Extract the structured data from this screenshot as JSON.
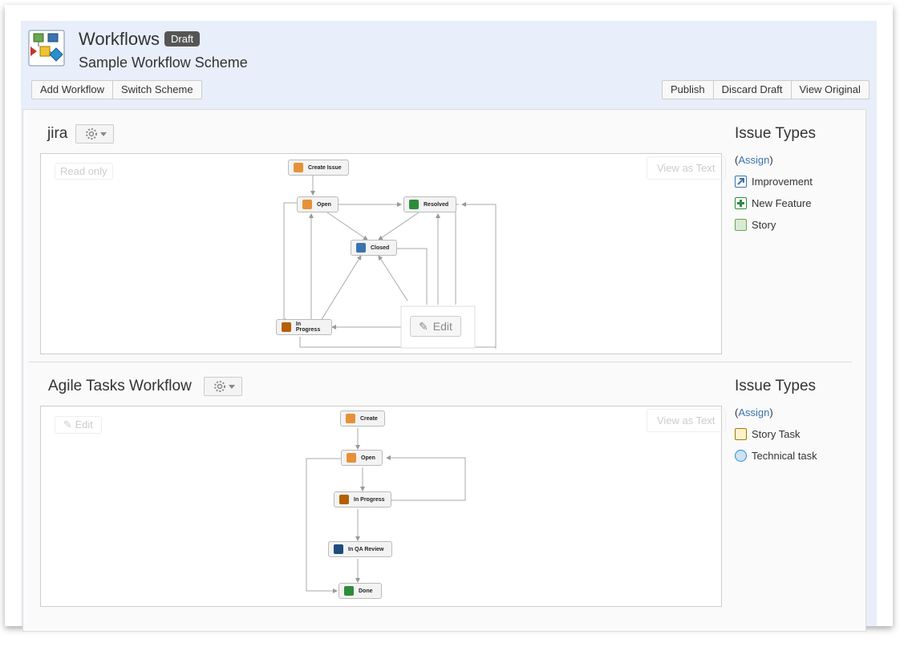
{
  "header": {
    "title": "Workflows",
    "badge": "Draft",
    "subtitle": "Sample Workflow Scheme",
    "left_buttons": [
      "Add Workflow",
      "Switch Scheme"
    ],
    "right_buttons": [
      "Publish",
      "Discard Draft",
      "View Original"
    ]
  },
  "workflows": [
    {
      "name": "jira",
      "mode_label": "Read only",
      "view_text_label": "View as Text",
      "edit_label": "Edit",
      "nodes": [
        "Create Issue",
        "Open",
        "Resolved",
        "Closed",
        "In Progress"
      ],
      "issue_types_title": "Issue Types",
      "assign_label": "Assign",
      "issue_types": [
        {
          "label": "Improvement",
          "icon": "improvement-icon",
          "color": "#3b73af"
        },
        {
          "label": "New Feature",
          "icon": "new-feature-icon",
          "color": "#2e8b3a"
        },
        {
          "label": "Story",
          "icon": "story-icon",
          "color": "#6aa84f"
        }
      ]
    },
    {
      "name": "Agile Tasks Workflow",
      "edit_label": "Edit",
      "view_text_label": "View as Text",
      "nodes": [
        "Create",
        "Open",
        "In Progress",
        "In QA Review",
        "Done"
      ],
      "issue_types_title": "Issue Types",
      "assign_label": "Assign",
      "issue_types": [
        {
          "label": "Story Task",
          "icon": "story-task-icon",
          "color": "#c8a400"
        },
        {
          "label": "Technical task",
          "icon": "technical-task-icon",
          "color": "#2a8fd0"
        }
      ]
    }
  ],
  "colors": {
    "header_bg": "#e8effa",
    "link": "#3b73af",
    "badge_bg": "#555555"
  }
}
